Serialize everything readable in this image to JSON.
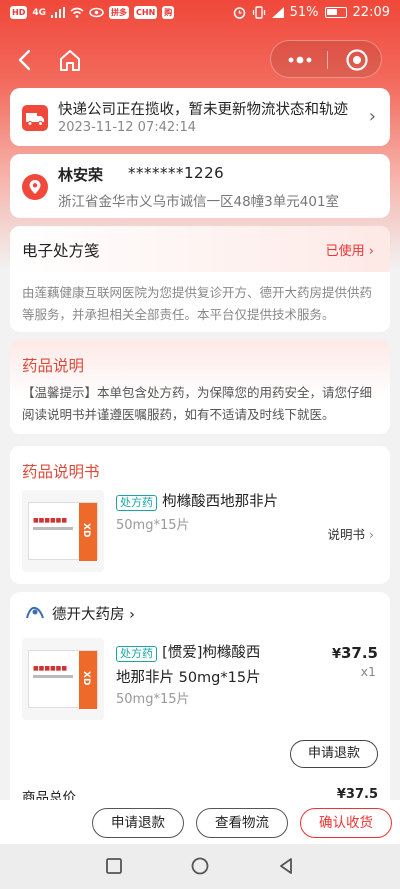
{
  "status_bar": {
    "carrier": "HD",
    "signal": "4G",
    "app_chips": [
      "拼多",
      "CHN",
      "购"
    ],
    "battery": "51%",
    "time": "22:09"
  },
  "logistics": {
    "message": "快递公司正在揽收，暂未更新物流状态和轨迹",
    "time": "2023-11-12 07:42:14"
  },
  "address": {
    "name": "林安荣",
    "phone": "*******1226",
    "detail": "浙江省金华市义乌市诚信一区48幢3单元401室"
  },
  "prescription": {
    "title": "电子处方笺",
    "status": "已使用",
    "note": "由莲藕健康互联网医院为您提供复诊开方、德开大药房提供供药等服务，并承担相关全部责任。本平台仅提供技术服务。"
  },
  "drug_explain": {
    "title": "药品说明",
    "text": "【温馨提示】本单包含处方药，为保障您的用药安全，请您仔细阅读说明书并谨遵医嘱服药，如有不适请及时线下就医。"
  },
  "manual": {
    "title": "药品说明书",
    "badge": "处方药",
    "name": "枸橼酸西地那非片",
    "spec": "50mg*15片",
    "link": "说明书",
    "box_label": "XD"
  },
  "pharmacy": {
    "store": "德开大药房",
    "badge": "处方药",
    "name_line1": "[惯爱]枸橼酸西",
    "name_line2": "地那非片 50mg*15片",
    "spec": "50mg*15片",
    "price_symbol": "¥",
    "price": "37.5",
    "qty": "x1",
    "refund_btn": "申请退款",
    "total_label": "商品总价",
    "total_value": "¥37.5"
  },
  "actions": {
    "refund": "申请退款",
    "logistics": "查看物流",
    "confirm": "确认收货"
  },
  "colors": {
    "brand_red": "#f0483a",
    "rx_teal": "#1aa5a5"
  }
}
